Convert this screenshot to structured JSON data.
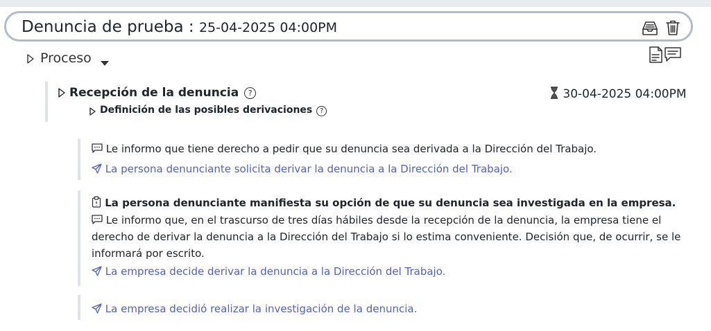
{
  "header": {
    "title": "Denuncia de prueba",
    "separator": " : ",
    "date": "25-04-2025 04:00PM"
  },
  "process": {
    "label": "Proceso"
  },
  "stage": {
    "title": "Recepción de la denuncia",
    "help": "?",
    "due": "30-04-2025 04:00PM",
    "substep": "Definición de las posibles derivaciones",
    "substep_help": "?"
  },
  "blocks": [
    {
      "info": "Le informo que tiene derecho a pedir que su denuncia sea derivada a la Dirección del Trabajo.",
      "action": "La persona denunciante solicita derivar la denuncia a la Dirección del Trabajo."
    },
    {
      "note": "La persona denunciante manifiesta su opción de que su denuncia sea investigada en la empresa.",
      "info_lines": [
        "Le informo que, en el trascurso de tres días hábiles desde la recepción de la denuncia, la empresa tiene el",
        "derecho de derivar la denuncia a la Dirección del Trabajo si lo estima conveniente. Decisión que, de ocurrir, se le",
        "informará por escrito."
      ],
      "action": "La empresa decide derivar la denuncia a la Dirección del Trabajo."
    },
    {
      "action": "La empresa decidió realizar la investigación de la denuncia."
    }
  ],
  "icons": {
    "archive": "archive-icon",
    "trash": "trash-icon",
    "doc_comments": "document-comments-icon",
    "hourglass": "hourglass-icon",
    "chat": "chat-icon",
    "clipboard": "clipboard-icon",
    "send": "send-icon"
  },
  "colors": {
    "link": "#4f5fd8",
    "border": "#b3bcc4"
  }
}
